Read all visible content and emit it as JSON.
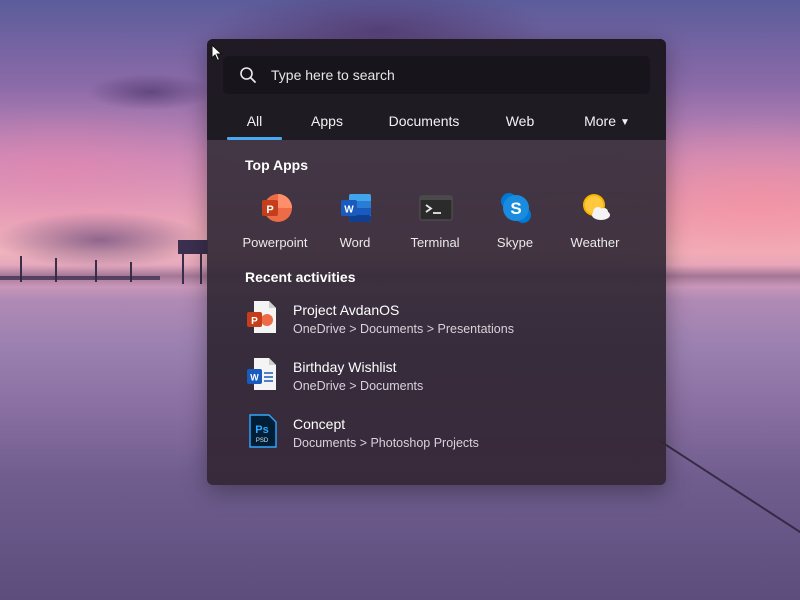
{
  "search": {
    "placeholder": "Type here to search",
    "icon": "search-icon"
  },
  "tabs": [
    {
      "label": "All",
      "active": true
    },
    {
      "label": "Apps",
      "active": false
    },
    {
      "label": "Documents",
      "active": false
    },
    {
      "label": "Web",
      "active": false
    },
    {
      "label": "More",
      "active": false,
      "dropdown": true
    }
  ],
  "accent_color": "#4aa8f0",
  "top_apps": {
    "title": "Top Apps",
    "items": [
      {
        "label": "Powerpoint",
        "icon": "powerpoint-icon"
      },
      {
        "label": "Word",
        "icon": "word-icon"
      },
      {
        "label": "Terminal",
        "icon": "terminal-icon"
      },
      {
        "label": "Skype",
        "icon": "skype-icon"
      },
      {
        "label": "Weather",
        "icon": "weather-icon"
      }
    ]
  },
  "recent": {
    "title": "Recent activities",
    "items": [
      {
        "title": "Project AvdanOS",
        "path": "OneDrive > Documents > Presentations",
        "icon": "powerpoint-file-icon"
      },
      {
        "title": "Birthday Wishlist",
        "path": "OneDrive > Documents",
        "icon": "word-file-icon"
      },
      {
        "title": "Concept",
        "path": "Documents > Photoshop Projects",
        "icon": "photoshop-file-icon"
      }
    ]
  }
}
